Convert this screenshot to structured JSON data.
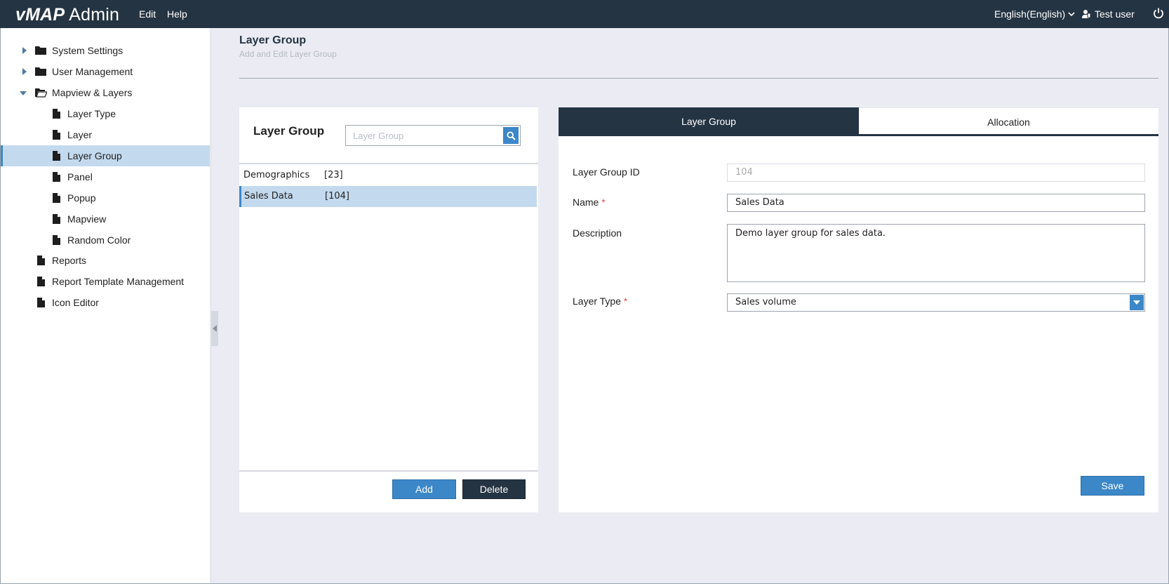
{
  "app": {
    "logo_brand": "vMAP",
    "logo_suffix": "Admin",
    "menu": [
      "Edit",
      "Help"
    ],
    "language": "English(English)",
    "user": "Test user"
  },
  "sidebar": {
    "items": [
      {
        "label": "System Settings",
        "icon": "folder-icon",
        "expander": "caret-right-icon"
      },
      {
        "label": "User Management",
        "icon": "folder-icon",
        "expander": "caret-right-icon"
      },
      {
        "label": "Mapview & Layers",
        "icon": "folder-open-icon",
        "expander": "caret-down-icon"
      },
      {
        "label": "Layer Type",
        "icon": "file-icon"
      },
      {
        "label": "Layer",
        "icon": "file-icon"
      },
      {
        "label": "Layer Group",
        "icon": "file-icon",
        "active": true
      },
      {
        "label": "Panel",
        "icon": "file-icon"
      },
      {
        "label": "Popup",
        "icon": "file-icon"
      },
      {
        "label": "Mapview",
        "icon": "file-icon"
      },
      {
        "label": "Random Color",
        "icon": "file-icon"
      },
      {
        "label": "Reports",
        "icon": "file-icon"
      },
      {
        "label": "Report Template Management",
        "icon": "file-icon"
      },
      {
        "label": "Icon Editor",
        "icon": "file-icon"
      }
    ]
  },
  "page": {
    "title": "Layer Group",
    "subtitle": "Add and Edit Layer Group"
  },
  "list_panel": {
    "title": "Layer Group",
    "search_placeholder": "Layer Group",
    "rows": [
      {
        "name": "Demographics",
        "id": "[23]"
      },
      {
        "name": "Sales Data",
        "id": "[104]",
        "selected": true
      }
    ],
    "add_label": "Add",
    "delete_label": "Delete"
  },
  "detail_panel": {
    "tabs": [
      {
        "label": "Layer Group",
        "active": true
      },
      {
        "label": "Allocation",
        "active": false
      }
    ],
    "fields": {
      "id_label": "Layer Group ID",
      "id_value": "104",
      "name_label": "Name",
      "name_value": "Sales Data",
      "description_label": "Description",
      "description_value": "Demo layer group for sales data.",
      "layer_type_label": "Layer Type",
      "layer_type_value": "Sales volume",
      "required_mark": "*"
    },
    "save_label": "Save"
  },
  "colors": {
    "topbar": "#253443",
    "accent_blue": "#3b87c8",
    "selection": "#c3d9ee",
    "content_bg": "#ebecf3"
  }
}
